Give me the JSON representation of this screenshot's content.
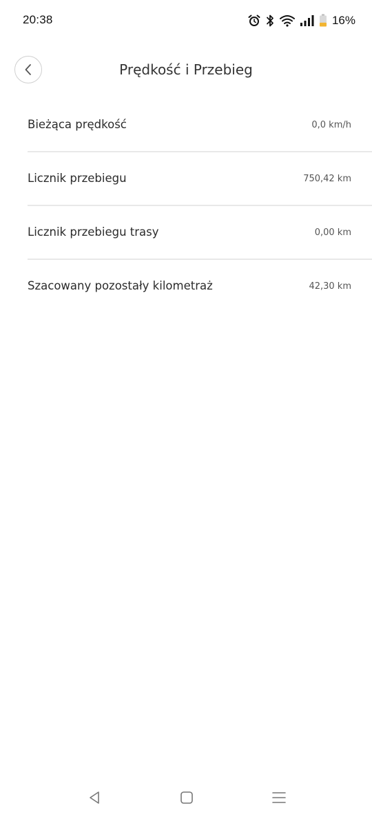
{
  "status_bar": {
    "time": "20:38",
    "battery_percent": "16%",
    "battery_level": 0.16,
    "battery_color": "#f2b532",
    "icons": [
      "alarm-icon",
      "bluetooth-icon",
      "wifi-icon",
      "signal-icon",
      "battery-icon"
    ]
  },
  "header": {
    "title": "Prędkość i Przebieg",
    "back_icon": "chevron-left-icon"
  },
  "rows": [
    {
      "label": "Bieżąca prędkość",
      "value": "0,0 km/h"
    },
    {
      "label": "Licznik przebiegu",
      "value": "750,42 km"
    },
    {
      "label": "Licznik przebiegu trasy",
      "value": "0,00 km"
    },
    {
      "label": "Szacowany pozostały kilometraż",
      "value": "42,30 km"
    }
  ],
  "nav_bar": {
    "icons": [
      "nav-back-icon",
      "nav-home-icon",
      "nav-menu-icon"
    ]
  }
}
